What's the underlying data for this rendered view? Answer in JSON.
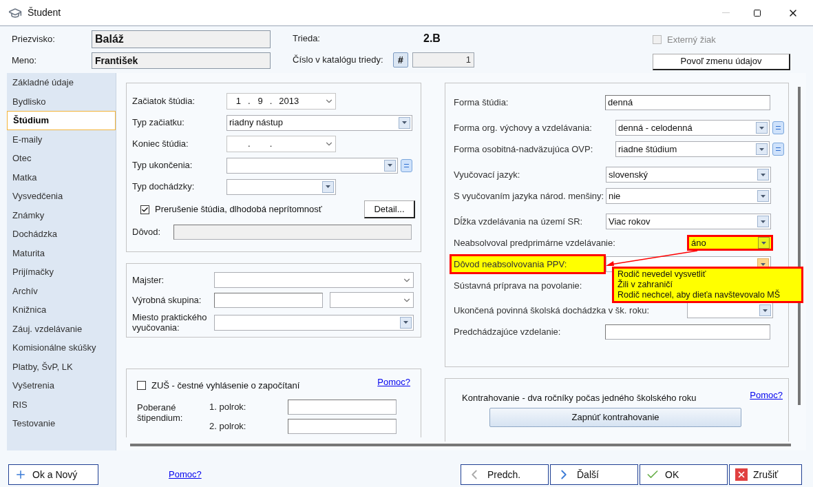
{
  "window": {
    "title": "Študent"
  },
  "header": {
    "surname_label": "Priezvisko:",
    "surname": "Baláž",
    "name_label": "Meno:",
    "name": "František",
    "class_label": "Trieda:",
    "class": "2.B",
    "catalog_label": "Číslo v katalógu triedy:",
    "catalog_button": "#",
    "catalog_number": "1",
    "external": {
      "label": "Externý žiak",
      "checked": false,
      "disabled": true
    },
    "permit_button": "Povoľ zmenu údajov"
  },
  "sidebar": {
    "items": [
      {
        "label": "Základné údaje",
        "selected": false
      },
      {
        "label": "Bydlisko",
        "selected": false
      },
      {
        "label": "Štúdium",
        "selected": true
      },
      {
        "label": "E-maily",
        "selected": false
      },
      {
        "label": "Otec",
        "selected": false
      },
      {
        "label": "Matka",
        "selected": false
      },
      {
        "label": "Vysvedčenia",
        "selected": false
      },
      {
        "label": "Známky",
        "selected": false
      },
      {
        "label": "Dochádzka",
        "selected": false
      },
      {
        "label": "Maturita",
        "selected": false
      },
      {
        "label": "Prijímačky",
        "selected": false
      },
      {
        "label": "Archív",
        "selected": false
      },
      {
        "label": "Knižnica",
        "selected": false
      },
      {
        "label": "Záuj. vzdelávanie",
        "selected": false
      },
      {
        "label": "Komisionálne skúšky",
        "selected": false
      },
      {
        "label": "Platby, ŠvP, LK",
        "selected": false
      },
      {
        "label": "Vyšetrenia",
        "selected": false
      },
      {
        "label": "RIS",
        "selected": false
      },
      {
        "label": "Testovanie",
        "selected": false
      }
    ]
  },
  "study_panel": {
    "fields": [
      {
        "kind": "date",
        "label": "Začiatok štúdia:",
        "day": "1",
        "month": "9",
        "year": "2013",
        "separator": "."
      },
      {
        "kind": "select",
        "label": "Typ začiatku:",
        "value": "riadny nástup"
      },
      {
        "kind": "date",
        "label": "Koniec štúdia:",
        "separator": "."
      },
      {
        "kind": "select_eq",
        "label": "Typ ukončenia:"
      },
      {
        "kind": "select_short",
        "label": "Typ dochádzky:"
      }
    ],
    "interruption": {
      "label": "Prerušenie štúdia, dlhodobá neprítomnosť",
      "checked": true
    },
    "detail_button": "Detail...",
    "reason_label": "Dôvod:"
  },
  "practice_panel": {
    "master_label": "Majster:",
    "group_label": "Výrobná skupina:",
    "place_label": "Miesto praktického vyučovania:"
  },
  "zus_panel": {
    "checkbox": {
      "label": "ZUŠ - čestné vyhlásenie o započítaní",
      "checked": false
    },
    "help_link": "Pomoc?",
    "stipend_label": "Poberané štipendium:",
    "terms": [
      "1. polrok:",
      "2. polrok:"
    ]
  },
  "form_panel": {
    "fields": [
      {
        "kind": "input",
        "label": "Forma štúdia:",
        "value": "denná",
        "highlighted": false
      },
      {
        "kind": "select_eq",
        "label": "Forma org. výchovy a vzdelávania:",
        "value": "denná - celodenná",
        "highlighted": false
      },
      {
        "kind": "select_eq",
        "label": "Forma osobitná-nadväzujúca OVP:",
        "value": "riadne štúdium",
        "highlighted": false
      },
      {
        "kind": "select",
        "label": "Vyučovací jazyk:",
        "value": "slovenský",
        "highlighted": false
      },
      {
        "kind": "select",
        "label": "S vyučovaním jazyka národ. menšiny:",
        "value": "nie",
        "highlighted": false
      },
      {
        "kind": "select",
        "label": "Dĺžka vzdelávania na území SR:",
        "value": "Viac rokov",
        "highlighted": false
      },
      {
        "kind": "select_small",
        "label": "Neabsolvoval predprimárne vzdelávanie:",
        "value": "áno",
        "highlighted": true
      },
      {
        "kind": "select_open",
        "label": "Dôvod neabsolvovania PPV:",
        "highlighted": true
      },
      {
        "kind": "label",
        "label": "Sústavná príprava na povolanie:",
        "highlighted": false
      },
      {
        "kind": "select_small",
        "label": "Ukončená povinná školská dochádzka v šk. roku:",
        "highlighted": false
      },
      {
        "kind": "input",
        "label": "Predchádzajúce vzdelanie:",
        "highlighted": false
      }
    ],
    "dropdown_options": [
      "Rodič nevedel vysvetliť",
      "Žili v zahraničí",
      "Rodič nechcel, aby dieťa navštevovalo MŠ"
    ]
  },
  "contra_panel": {
    "text": "Kontrahovanie - dva ročníky počas jedného školského roku",
    "help_link": "Pomoc?",
    "button": "Zapnúť kontrahovanie"
  },
  "footer": {
    "ok_new": "Ok a Nový",
    "help_link": "Pomoc?",
    "prev": "Predch.",
    "next": "Ďalší",
    "ok": "OK",
    "cancel": "Zrušiť"
  }
}
